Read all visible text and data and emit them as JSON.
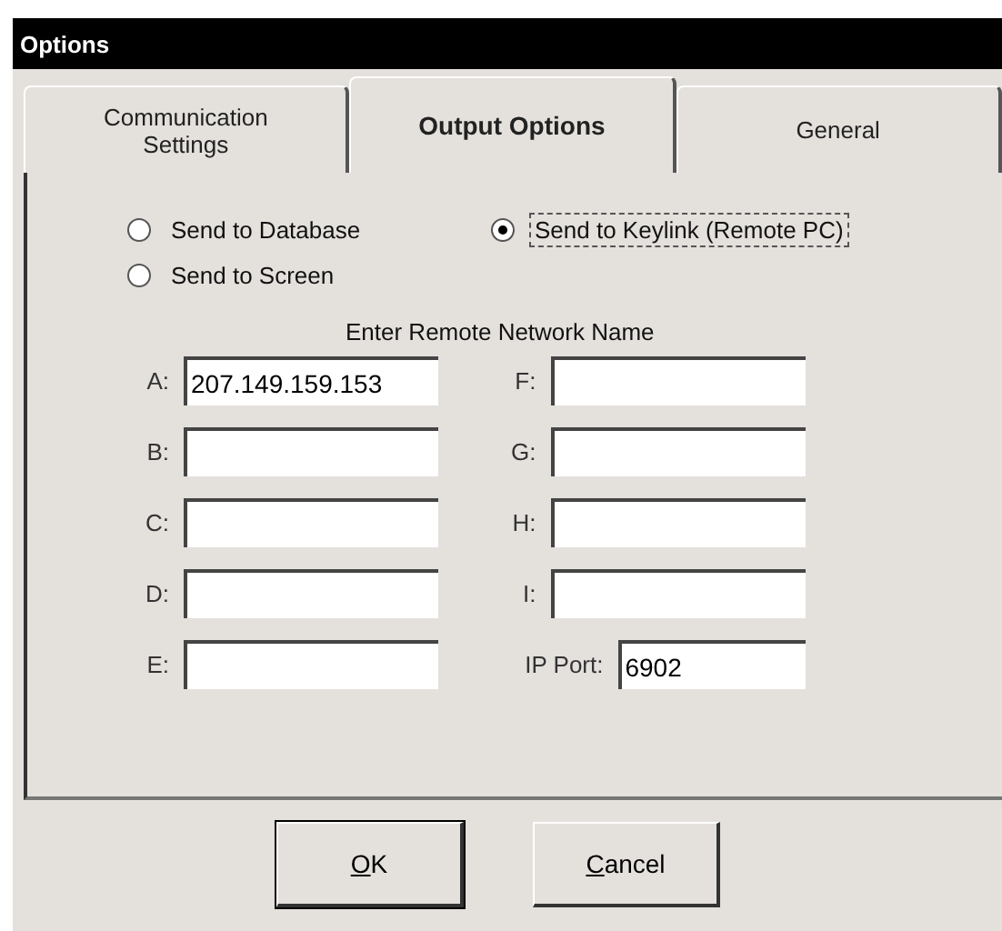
{
  "window": {
    "title": "Options"
  },
  "tabs": [
    {
      "label": "Communication Settings",
      "selected": false
    },
    {
      "label": "Output Options",
      "selected": true
    },
    {
      "label": "General",
      "selected": false
    }
  ],
  "output_options": [
    {
      "label": "Send to Database",
      "selected": false,
      "focused": false
    },
    {
      "label": "Send to Keylink (Remote PC)",
      "selected": true,
      "focused": true
    },
    {
      "label": "Send to Screen",
      "selected": false,
      "focused": false
    }
  ],
  "network_heading": "Enter Remote Network Name",
  "left_fields": [
    {
      "label": "A:",
      "value": "207.149.159.153"
    },
    {
      "label": "B:"
    },
    {
      "label": "C:"
    },
    {
      "label": "D:"
    },
    {
      "label": "E:"
    }
  ],
  "right_fields": [
    {
      "label": "F:"
    },
    {
      "label": "G:"
    },
    {
      "label": "H:"
    },
    {
      "label": "I:"
    },
    {
      "label": "IP Port:",
      "value": "6902",
      "kind": "short"
    }
  ],
  "buttons": [
    {
      "access_key": "O",
      "rest": "K",
      "default": true
    },
    {
      "access_key": "C",
      "rest": "ancel",
      "default": false
    }
  ]
}
